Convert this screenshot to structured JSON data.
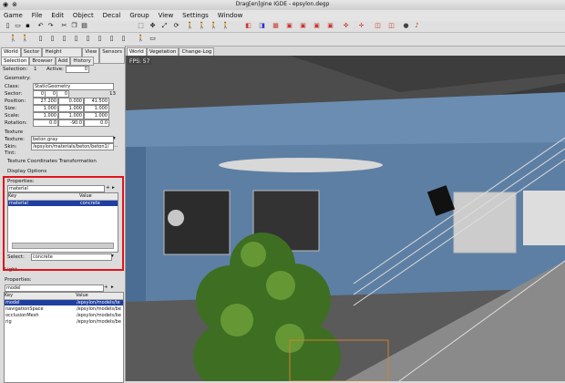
{
  "window": {
    "title": "Drag[en]gine IGDE - epsylon.degp"
  },
  "menu": [
    "Game",
    "File",
    "Edit",
    "Object",
    "Decal",
    "Group",
    "View",
    "Settings",
    "Window"
  ],
  "panel_tabs": [
    "World",
    "Sector",
    "Height Terrain",
    "View",
    "Sensors"
  ],
  "sub_tabs": [
    "Selection",
    "Browser",
    "Add",
    "History"
  ],
  "selection": {
    "label": "Selection:",
    "value": "1",
    "active_label": "Active:",
    "active_value": "0"
  },
  "geometry": {
    "title": "Geometry:",
    "class_label": "Class:",
    "class_value": "StaticGeometry",
    "sector_label": "Sector:",
    "sector": [
      "0",
      "0",
      "0",
      "13"
    ],
    "position_label": "Position:",
    "position": [
      "27.200",
      "0.000",
      "41.500"
    ],
    "size_label": "Size:",
    "size": [
      "1.000",
      "1.000",
      "1.000"
    ],
    "scale_label": "Scale:",
    "scale": [
      "1.000",
      "1.000",
      "1.000"
    ],
    "rotation_label": "Rotation:",
    "rotation": [
      "0.0",
      "-90.0",
      "0.0"
    ]
  },
  "texture": {
    "title": "Texture",
    "texture_label": "Texture:",
    "texture_value": "beton.gray",
    "skin_label": "Skin:",
    "skin_value": "/epsylon/materials/beton/beton1/",
    "tint_label": "Tint:",
    "coords_label": "Texture Coordinates Transformation"
  },
  "display_options": "Display Options",
  "tex_properties": {
    "title": "Properties:",
    "key_field": "material",
    "col_key": "Key",
    "col_value": "Value",
    "rows": [
      {
        "key": "material",
        "value": "concrete"
      }
    ],
    "select_label": "Select:",
    "select_value": "concrete"
  },
  "light": {
    "title": "Light"
  },
  "obj_properties": {
    "title": "Properties:",
    "key_field": "model",
    "col_key": "Key",
    "col_value": "Value",
    "rows": [
      {
        "key": "model",
        "value": "/epsylon/models/te"
      },
      {
        "key": "navigationSpace",
        "value": "/epsylon/models/be"
      },
      {
        "key": "occlusionMesh",
        "value": "/epsylon/models/be"
      },
      {
        "key": "rig",
        "value": "/epsylon/models/be"
      }
    ]
  },
  "view_tabs": [
    "World",
    "Vegetation",
    "Change-Log"
  ],
  "fps": "FPS: 57",
  "colors": {
    "selection": "#1e3ea0",
    "highlight": "#e0141b",
    "wall": "#5d7fa4",
    "floor": "#5a5a5a"
  }
}
